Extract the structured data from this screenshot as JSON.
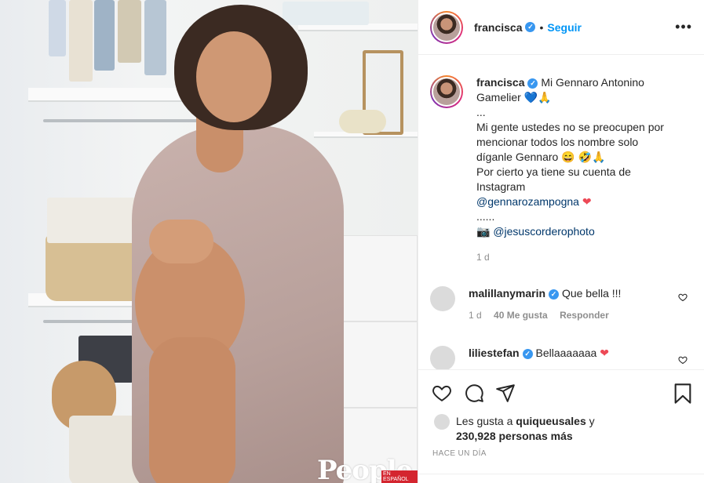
{
  "post": {
    "author": "francisca",
    "follow_label": "Seguir",
    "separator": "•",
    "more_label": "•••",
    "photo_watermark": "People",
    "photo_watermark_tag": "EN ESPAÑOL"
  },
  "caption": {
    "username": "francisca",
    "lines": [
      "Mi Gennaro Antonino",
      "Gamelier",
      "...",
      "Mi gente ustedes no se preocupen por",
      "mencionar todos los nombre solo",
      "díganle Gennaro 😄 🤣🙏",
      "Por cierto ya tiene su cuenta de",
      "Instagram"
    ],
    "line2_emoji": "💙🙏",
    "mention_1": "@gennarozampogna",
    "mention_1_emoji": "❤",
    "dots": "......",
    "camera_emoji": "📷",
    "mention_2": "@jesuscorderophoto",
    "time": "1 d"
  },
  "comments": [
    {
      "username": "malillanymarin",
      "text": "Que bella !!!",
      "time": "1 d",
      "likes": "40 Me gusta",
      "reply": "Responder"
    },
    {
      "username": "liliestefan",
      "text": "Bellaaaaaaa",
      "emoji": "❤"
    }
  ],
  "likes": {
    "prefix": "Les gusta a",
    "user": "quiqueusales",
    "connector": "y",
    "others": "230,928 personas más"
  },
  "timestamp": "HACE UN DÍA",
  "colors": {
    "link_blue": "#0095f6",
    "verified": "#3897f0",
    "mention": "#00376b",
    "heart": "#ed4956"
  },
  "icons": [
    "verified-icon",
    "more-icon",
    "like-icon",
    "comment-icon",
    "share-icon",
    "save-icon"
  ]
}
